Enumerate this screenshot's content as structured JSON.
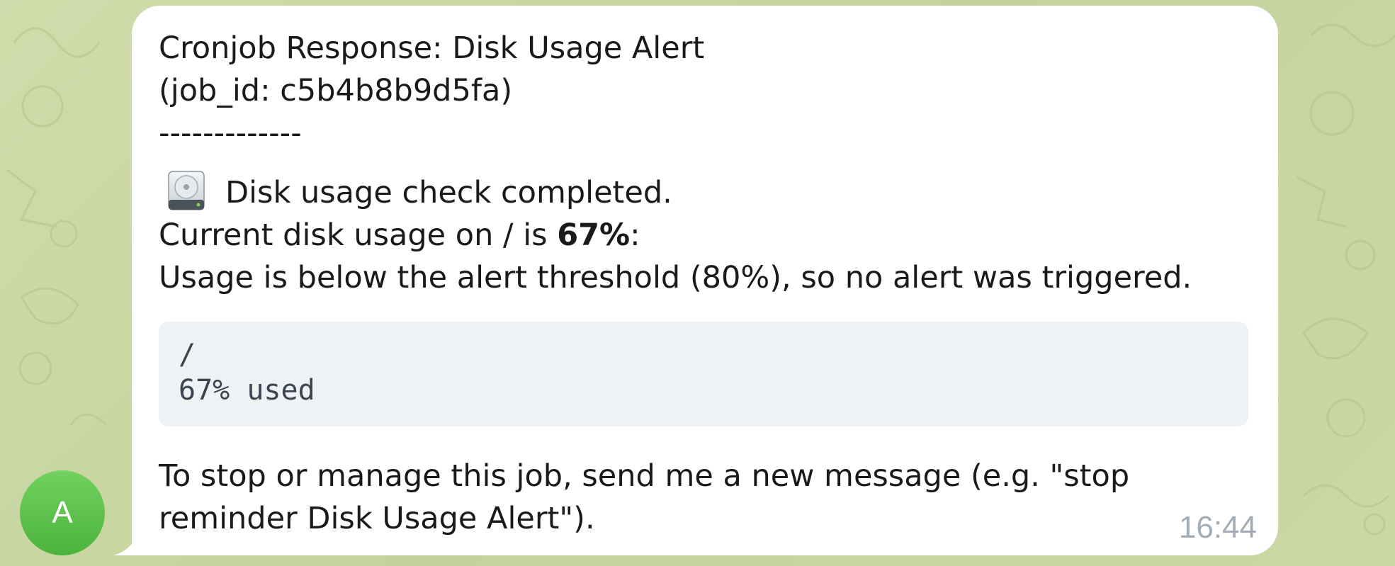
{
  "avatar": {
    "initial": "A",
    "color": "#5cc24a"
  },
  "message": {
    "title": "Cronjob Response: Disk Usage Alert",
    "job_id_line": "(job_id: c5b4b8b9d5fa)",
    "separator": "-------------",
    "status_icon": "hard-disk-icon",
    "status_text": "Disk usage check completed.",
    "usage_prefix": "Current disk usage on / is ",
    "usage_value": "67%",
    "usage_suffix": ":",
    "threshold_text": "Usage is below the alert threshold (80%), so no alert was triggered.",
    "code_block": {
      "mount": "/",
      "usage": "67% used"
    },
    "footer_text": "To stop or manage this job, send me a new message (e.g. \"stop reminder Disk Usage Alert\").",
    "timestamp": "16:44"
  },
  "colors": {
    "bubble": "#ffffff",
    "code_background": "#eef2f5",
    "timestamp": "#a4adb6",
    "chat_background": "#c9d6a4"
  }
}
